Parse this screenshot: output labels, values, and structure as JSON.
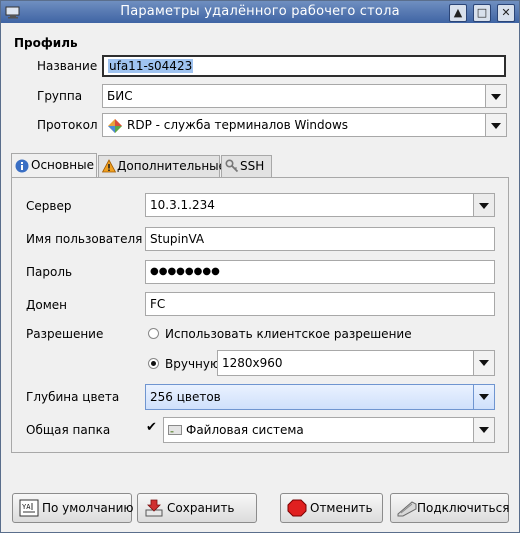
{
  "window": {
    "title": "Параметры удалённого рабочего стола",
    "buttons": [
      "▲",
      "□",
      "✕"
    ]
  },
  "profile": {
    "heading": "Профиль",
    "name_label": "Название",
    "name_value": "ufa11-s04423",
    "group_label": "Группа",
    "group_value": "БИС",
    "protocol_label": "Протокол",
    "protocol_value": "RDP - служба терминалов Windows"
  },
  "tabs": {
    "basic": "Основные",
    "advanced": "Дополнительные",
    "ssh": "SSH"
  },
  "basic": {
    "server_label": "Сервер",
    "server_value": "10.3.1.234",
    "user_label": "Имя пользователя",
    "user_value": "StupinVA",
    "password_label": "Пароль",
    "password_value": "●●●●●●●●",
    "domain_label": "Домен",
    "domain_value": "FC",
    "resolution_label": "Разрешение",
    "resolution_client": "Использовать клиентское разрешение",
    "resolution_manual": "Вручную",
    "resolution_value": "1280x960",
    "depth_label": "Глубина цвета",
    "depth_value": "256 цветов",
    "share_label": "Общая папка",
    "share_value": "Файловая система",
    "share_checked": "✔"
  },
  "buttons": {
    "default": "По умолчанию",
    "save": "Сохранить",
    "cancel": "Отменить",
    "connect": "Подключиться"
  }
}
